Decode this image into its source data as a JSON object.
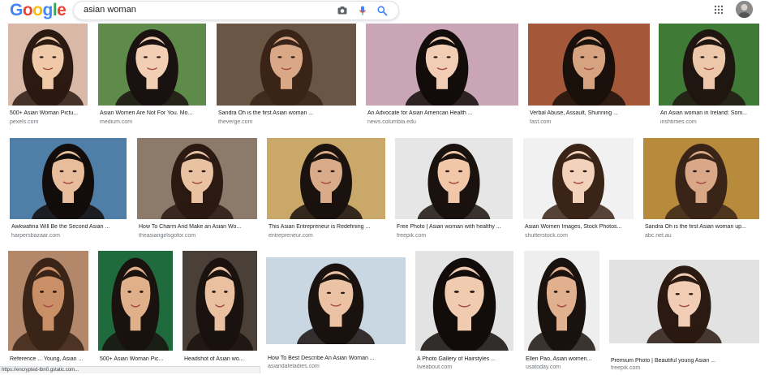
{
  "logo": {
    "letters": [
      "G",
      "o",
      "o",
      "g",
      "l",
      "e"
    ],
    "colors": [
      "#4285F4",
      "#EA4335",
      "#FBBC05",
      "#4285F4",
      "#34A853",
      "#EA4335"
    ]
  },
  "search": {
    "query": "asian woman"
  },
  "icons": {
    "camera": "camera-icon",
    "mic": "mic-icon",
    "search": "search-icon",
    "apps": "apps-grid-icon"
  },
  "results": [
    {
      "caption": "500+ Asian Woman Pictu...",
      "source": "pexels.com",
      "bg": "#d9b8a8",
      "hair": "#2b1a12",
      "skin": "#f0c9a8"
    },
    {
      "caption": "Asian Women Are Not For You. Mo...",
      "source": "medium.com",
      "bg": "#5f8b4a",
      "hair": "#1a1210",
      "skin": "#f2cfb4"
    },
    {
      "caption": "Sandra Oh is the first Asian woman ...",
      "source": "theverge.com",
      "bg": "#6b5545",
      "hair": "#3a2418",
      "skin": "#d9a987"
    },
    {
      "caption": "An Advocate for Asian American Health ...",
      "source": "news.columbia.edu",
      "bg": "#c9a5b6",
      "hair": "#120c0a",
      "skin": "#f0cdb4"
    },
    {
      "caption": "Verbal Abuse, Assault, Shunning ...",
      "source": "fast.com",
      "bg": "#a5573a",
      "hair": "#1a100b",
      "skin": "#d6a27f"
    },
    {
      "caption": "An Asian woman in Ireland: Som...",
      "source": "irishtimes.com",
      "bg": "#3f7a36",
      "hair": "#201611",
      "skin": "#ecc7a9"
    },
    {
      "caption": "Awkwafina Will Be the Second Asian ...",
      "source": "harpersbazaar.com",
      "bg": "#4f7ea6",
      "hair": "#120d0b",
      "skin": "#e7bd9c"
    },
    {
      "caption": "How To Charm And Make an Asian Wo...",
      "source": "theasiangirlsgofor.com",
      "bg": "#8c7a6a",
      "hair": "#2a1a12",
      "skin": "#e9c2a2"
    },
    {
      "caption": "This Asian Entrepreneur is Redefining ...",
      "source": "entrepreneur.com",
      "bg": "#c9a86a",
      "hair": "#1a120e",
      "skin": "#d9ab88"
    },
    {
      "caption": "Free Photo | Asian woman with healthy ...",
      "source": "freepik.com",
      "bg": "#e6e6e6",
      "hair": "#1a120e",
      "skin": "#f0c7a8"
    },
    {
      "caption": "Asian Women Images, Stock Photos...",
      "source": "shutterstock.com",
      "bg": "#f1f1f1",
      "hair": "#3a2418",
      "skin": "#f3d2bb"
    },
    {
      "caption": "Sandra Oh is the first Asian woman up...",
      "source": "abc.net.au",
      "bg": "#b78a3c",
      "hair": "#3a2418",
      "skin": "#d9a987"
    },
    {
      "caption": "Reference ... Young, Asian ...",
      "source": "",
      "bg": "#b2876a",
      "hair": "#3a2418",
      "skin": "#c98f66"
    },
    {
      "caption": "500+ Asian Woman Pic...",
      "source": "",
      "bg": "#1f6b3e",
      "hair": "#1a120e",
      "skin": "#e0b08b"
    },
    {
      "caption": "Headshot of Asian wo...",
      "source": "",
      "bg": "#4a4038",
      "hair": "#1a120e",
      "skin": "#e9c0a0"
    },
    {
      "caption": "How To Best Describe An Asian Woman ...",
      "source": "asiandateladies.com",
      "bg": "#c9d7e3",
      "hair": "#1a120e",
      "skin": "#ebc3a4"
    },
    {
      "caption": "A Photo Gallery of Hairstyles ...",
      "source": "liveabout.com",
      "bg": "#e3e3e3",
      "hair": "#120d0b",
      "skin": "#f0cbb0"
    },
    {
      "caption": "Ellen Pao, Asian women...",
      "source": "usatoday.com",
      "bg": "#eeeeee",
      "hair": "#1a120e",
      "skin": "#e0b08f"
    },
    {
      "caption": "Premium Photo | Beautiful young Asian ...",
      "source": "freepik.com",
      "bg": "#e2e2e2",
      "hair": "#2a1a12",
      "skin": "#f0cdb4"
    }
  ],
  "status_bar": {
    "text": "https://encrypted-tbn0.gstatic.com..."
  }
}
